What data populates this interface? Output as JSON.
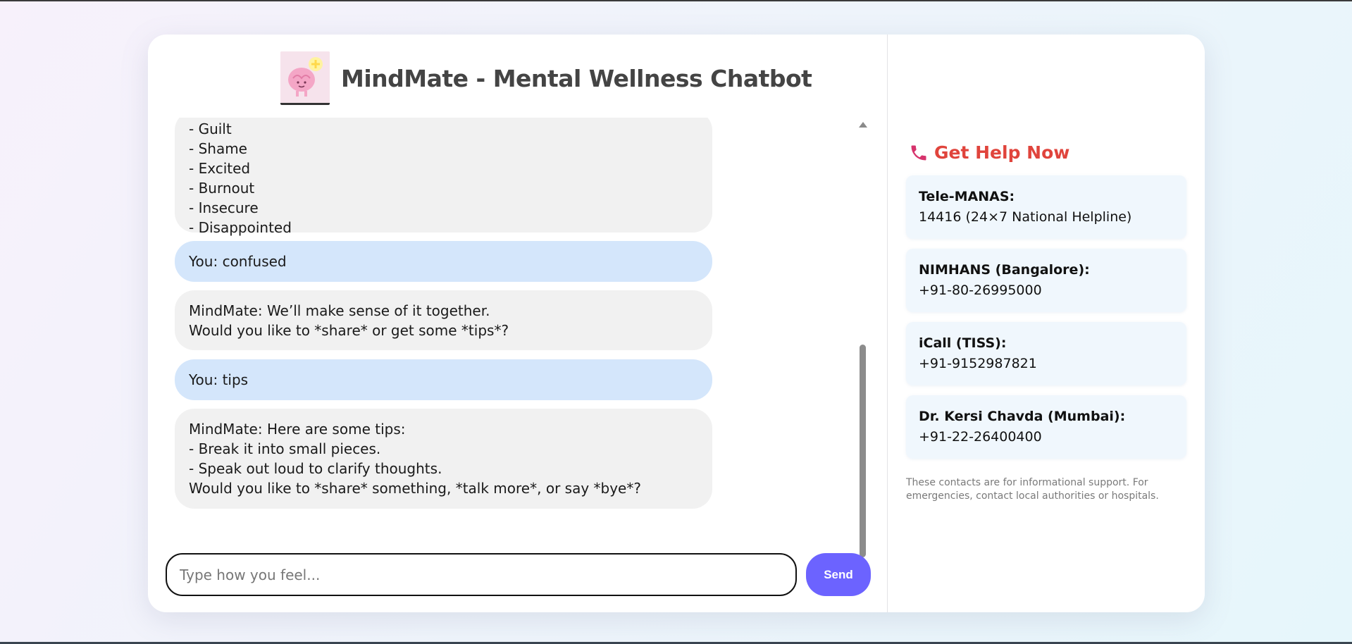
{
  "header": {
    "title": "MindMate - Mental Wellness Chatbot"
  },
  "messages": [
    {
      "role": "bot",
      "lines": [
        "- Guilt",
        "- Shame",
        "- Excited",
        "- Burnout",
        "- Insecure",
        "- Disappointed"
      ]
    },
    {
      "role": "user",
      "lines": [
        "You: confused"
      ]
    },
    {
      "role": "bot",
      "lines": [
        "MindMate: We’ll make sense of it together.",
        "Would you like to *share* or get some *tips*?"
      ]
    },
    {
      "role": "user",
      "lines": [
        "You: tips"
      ]
    },
    {
      "role": "bot",
      "lines": [
        "MindMate: Here are some tips:",
        "- Break it into small pieces.",
        "- Speak out loud to clarify thoughts.",
        "Would you like to *share* something, *talk more*, or say *bye*?"
      ]
    }
  ],
  "input": {
    "placeholder": "Type how you feel...",
    "value": ""
  },
  "send_label": "Send",
  "help": {
    "title": "Get Help Now",
    "contacts": [
      {
        "name": "Tele-MANAS:",
        "number": "14416 (24×7 National Helpline)"
      },
      {
        "name": "NIMHANS (Bangalore):",
        "number": "+91-80-26995000"
      },
      {
        "name": "iCall (TISS):",
        "number": "+91-9152987821"
      },
      {
        "name": "Dr. Kersi Chavda (Mumbai):",
        "number": "+91-22-26400400"
      }
    ],
    "disclaimer": "These contacts are for informational support. For emergencies, contact local authorities or hospitals."
  },
  "colors": {
    "accent": "#6c63ff",
    "help_title": "#e0443c",
    "user_bubble": "#d4e6fb",
    "bot_bubble": "#f1f1f1"
  },
  "icons": {
    "logo": "brain-logo-icon",
    "help": "phone-icon"
  }
}
